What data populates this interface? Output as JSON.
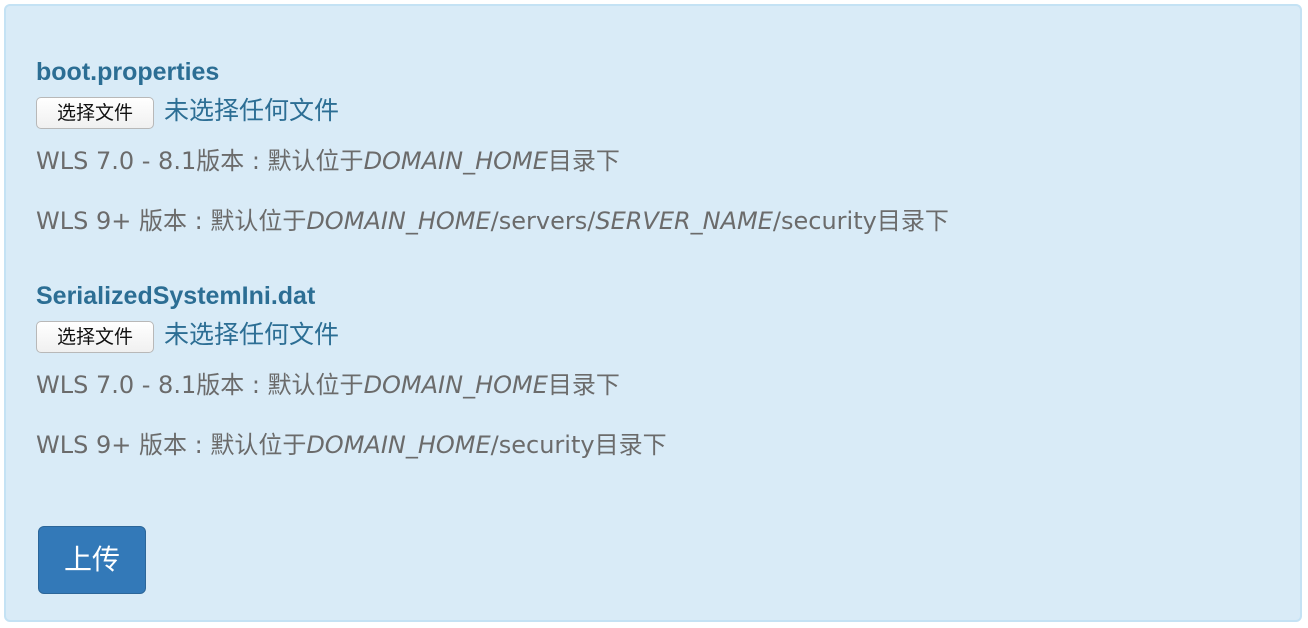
{
  "files": [
    {
      "title": "boot.properties",
      "button_label": "选择文件",
      "status": "未选择任何文件",
      "note1": {
        "prefix": "WLS 7.0 - 8.1版本 : 默认位于",
        "path": [
          {
            "text": "DOMAIN_HOME",
            "italic": true
          }
        ],
        "suffix": "目录下"
      },
      "note2": {
        "prefix": "WLS 9+ 版本 : 默认位于",
        "path": [
          {
            "text": "DOMAIN_HOME",
            "italic": true
          },
          {
            "text": "/servers/",
            "italic": false
          },
          {
            "text": "SERVER_NAME",
            "italic": true
          },
          {
            "text": "/security",
            "italic": false
          }
        ],
        "suffix": "目录下"
      }
    },
    {
      "title": "SerializedSystemIni.dat",
      "button_label": "选择文件",
      "status": "未选择任何文件",
      "note1": {
        "prefix": "WLS 7.0 - 8.1版本 : 默认位于",
        "path": [
          {
            "text": "DOMAIN_HOME",
            "italic": true
          }
        ],
        "suffix": "目录下"
      },
      "note2": {
        "prefix": "WLS 9+ 版本 : 默认位于",
        "path": [
          {
            "text": "DOMAIN_HOME",
            "italic": true
          },
          {
            "text": "/security",
            "italic": false
          }
        ],
        "suffix": "目录下"
      }
    }
  ],
  "upload_label": "上传",
  "colors": {
    "panel_bg": "#d9ebf7",
    "panel_border": "#c4e2f4",
    "title": "#2c6e94",
    "note_text": "#6b6b6b",
    "primary_button": "#3379b8"
  }
}
